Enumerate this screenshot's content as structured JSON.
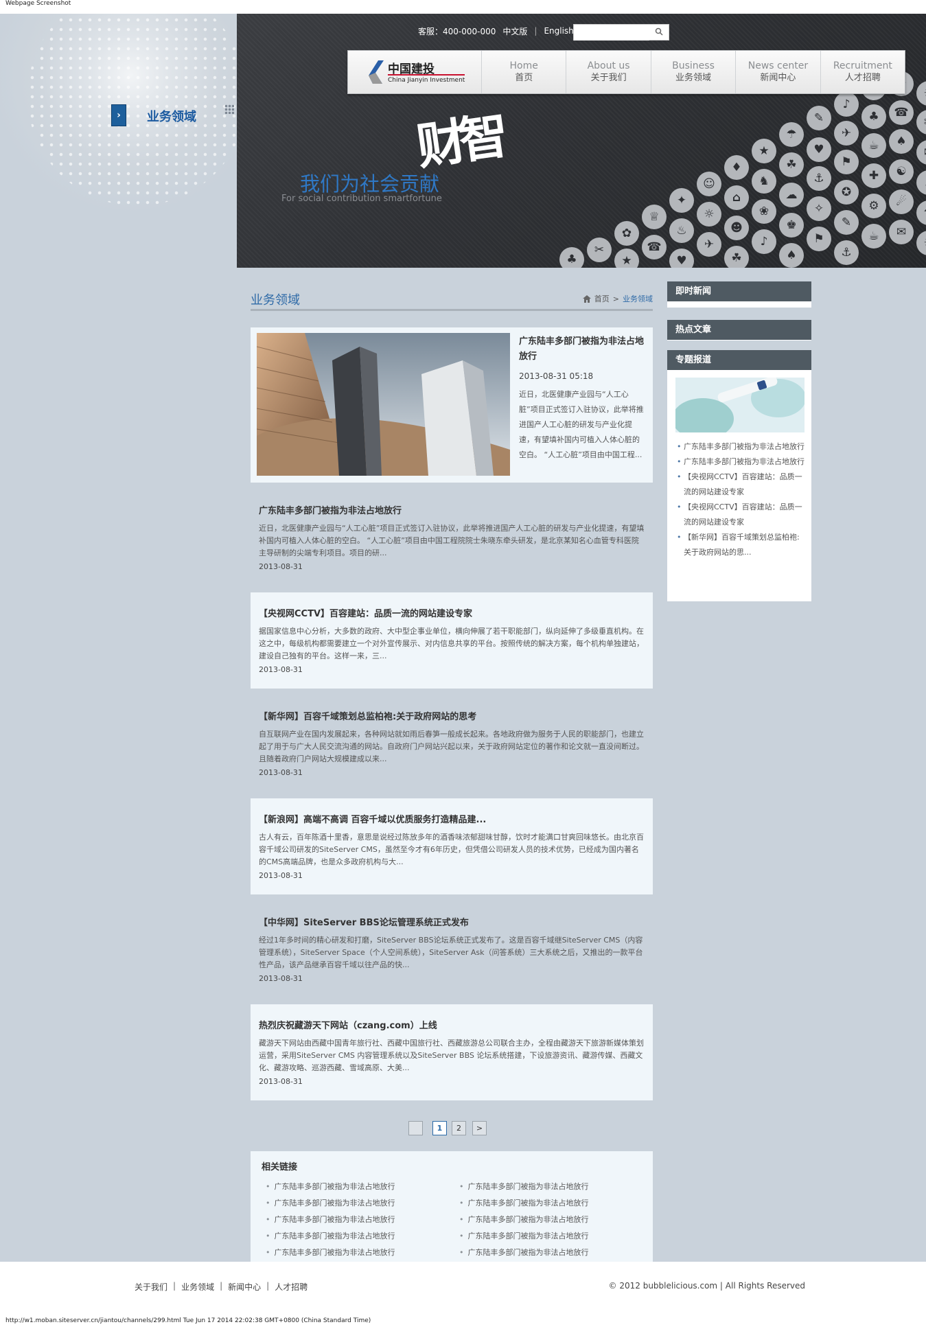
{
  "caption": "Webpage Screenshot",
  "status_url": "http://w1.moban.siteserver.cn/jiantou/channels/299.html Tue Jun 17 2014 22:02:38 GMT+0800 (China Standard Time)",
  "topbar": {
    "hotline": "客服：400-000-000",
    "lang_cn": "中文版",
    "divider": "|",
    "lang_en": "English",
    "search_placeholder": ""
  },
  "logo": {
    "cn": "中国建投",
    "en": "China Jianyin Investment"
  },
  "nav": [
    {
      "en": "Home",
      "cn": "首页"
    },
    {
      "en": "About us",
      "cn": "关于我们"
    },
    {
      "en": "Business",
      "cn": "业务领域"
    },
    {
      "en": "News center",
      "cn": "新闻中心"
    },
    {
      "en": "Recruitment",
      "cn": "人才招聘"
    }
  ],
  "left_menu": {
    "arrow": "›",
    "title": "业务领域"
  },
  "banner": {
    "slogan_cn": "我们为社会贡献",
    "slogan_en": "For social contribution smartfortune",
    "calligraphy": "财智"
  },
  "section": {
    "title": "业务领域",
    "crumb_home": "首页",
    "crumb_sep": ">",
    "crumb_current": "业务领域"
  },
  "feature": {
    "title": "广东陆丰多部门被指为非法占地放行",
    "date": "2013-08-31 05:18",
    "text": "近日，北医健康产业园与“人工心脏”项目正式签订入驻协议，此举将推进国产人工心脏的研发与产业化提速，有望填补国内可植入人体心脏的空白。 “人工心脏”项目由中国工程..."
  },
  "articles": [
    {
      "title": "广东陆丰多部门被指为非法占地放行",
      "text": "近日，北医健康产业园与“人工心脏”项目正式签订入驻协议，此举将推进国产人工心脏的研发与产业化提速，有望填补国内可植入人体心脏的空白。 “人工心脏”项目由中国工程院院士朱晓东牵头研发，是北京某知名心血管专科医院主导研制的尖端专利项目。项目的研...",
      "date": "2013-08-31"
    },
    {
      "title": "【央视网CCTV】百容建站：品质一流的网站建设专家",
      "text": "据国家信息中心分析，大多数的政府、大中型企事业单位，横向伸展了若干职能部门，纵向延伸了多级垂直机构。在这之中，每级机构都需要建立一个对外宣传展示、对内信息共享的平台。按照传统的解决方案，每个机构单独建站，建设自己独有的平台。这样一来，三...",
      "date": "2013-08-31"
    },
    {
      "title": "【新华网】百容千域策划总监柏袍:关于政府网站的思考",
      "text": "自互联网产业在国内发展起来，各种网站就如雨后春笋一般成长起来。各地政府做为服务于人民的职能部门，也建立起了用于与广大人民交流沟通的网站。自政府门户网站兴起以来，关于政府网站定位的著作和论文就一直没间断过。且随着政府门户网站大规模建成以来...",
      "date": "2013-08-31"
    },
    {
      "title": "【新浪网】高端不高调 百容千域以优质服务打造精品建...",
      "text": "古人有云，百年陈酒十里香，意思是说经过陈放多年的酒香味浓郁甜味甘醇，饮时才能满口甘爽回味悠长。由北京百容千域公司研发的SiteServer CMS，虽然至今才有6年历史，但凭借公司研发人员的技术优势，已经成为国内著名的CMS高端品牌，也是众多政府机构与大...",
      "date": "2013-08-31"
    },
    {
      "title": "【中华网】SiteServer BBS论坛管理系统正式发布",
      "text": "经过1年多时间的精心研发和打磨，SiteServer BBS论坛系统正式发布了。这是百容千域继SiteServer CMS（内容管理系统），SiteServer Space（个人空间系统），SiteServer Ask（问答系统）三大系统之后，又推出的一款平台性产品，该产品继承百容千域以往产品的快...",
      "date": "2013-08-31"
    },
    {
      "title": "热烈庆祝藏游天下网站（czang.com）上线",
      "text": "藏游天下网站由西藏中国青年旅行社、西藏中国旅行社、西藏旅游总公司联合主办，全程由藏游天下旅游新媒体策划运营，采用SiteServer CMS 内容管理系统以及SiteServer BBS 论坛系统搭建，下设旅游资讯、藏游传媒、西藏文化、藏游攻略、巡游西藏、雪域高原、大美...",
      "date": "2013-08-31"
    }
  ],
  "pager": {
    "prev": "",
    "pages": [
      "1",
      "2"
    ],
    "next": ">"
  },
  "related": {
    "title": "相关链接",
    "left": [
      "广东陆丰多部门被指为非法占地放行",
      "广东陆丰多部门被指为非法占地放行",
      "广东陆丰多部门被指为非法占地放行",
      "广东陆丰多部门被指为非法占地放行",
      "广东陆丰多部门被指为非法占地放行"
    ],
    "right": [
      "广东陆丰多部门被指为非法占地放行",
      "广东陆丰多部门被指为非法占地放行",
      "广东陆丰多部门被指为非法占地放行",
      "广东陆丰多部门被指为非法占地放行",
      "广东陆丰多部门被指为非法占地放行"
    ]
  },
  "sidebar": {
    "box1": "即时新闻",
    "box2": "热点文章",
    "box3": "专题报道",
    "list": [
      "广东陆丰多部门被指为非法占地放行",
      "广东陆丰多部门被指为非法占地放行",
      "【央视网CCTV】百容建站：品质一流的网站建设专家",
      "【央视网CCTV】百容建站：品质一流的网站建设专家",
      "【新华网】百容千域策划总监柏袍:关于政府网站的思..."
    ]
  },
  "footer": {
    "links": [
      "关于我们",
      "业务领域",
      "新闻中心",
      "人才招聘"
    ],
    "sep": "|",
    "copyright": "© 2012 bubblelicious.com | All Rights Reserved"
  }
}
